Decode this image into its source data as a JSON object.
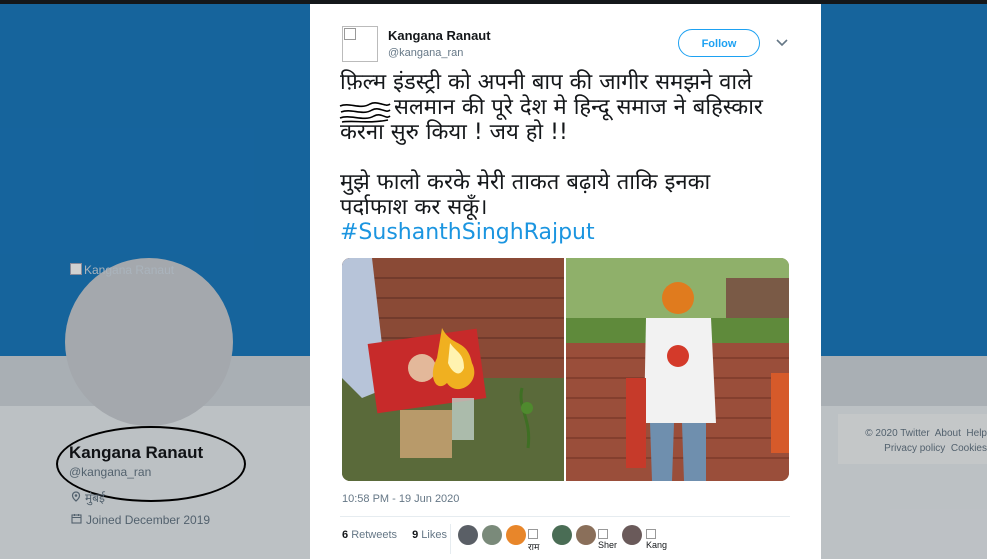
{
  "background_profile": {
    "avatar_alt": "Kangana Ranaut",
    "name": "Kangana Ranaut",
    "handle": "@kangana_ran",
    "location": "मुंबई",
    "joined": "Joined December 2019",
    "location_icon": "location-pin-icon",
    "calendar_icon": "calendar-icon"
  },
  "footer": {
    "row1": [
      "© 2020 Twitter",
      "About",
      "Help"
    ],
    "row2": [
      "Privacy policy",
      "Cookies"
    ]
  },
  "tweet": {
    "author_name": "Kangana Ranaut",
    "author_handle": "@kangana_ran",
    "follow_label": "Follow",
    "text_line1": "फ़िल्म इंडस्ट्री को अपनी बाप की जागीर समझने वाले",
    "text_line2": "सलमान की पूरे देश मे हिन्दू समाज ने बहिस्कार",
    "text_line3": "करना सुरु किया ! जय हो !!",
    "text_line4": "मुझे फालो करके मेरी ताकत बढ़ाये ताकि इनका",
    "text_line5": "पर्दाफाश कर सकूँ।",
    "hashtag": "#SushanthSinghRajput",
    "timestamp": "10:58 PM - 19 Jun 2020",
    "retweets_count": "6",
    "retweets_label": "Retweets",
    "likes_count": "9",
    "likes_label": "Likes",
    "likers_text": [
      "राम",
      "Sher",
      "Kang"
    ]
  },
  "colors": {
    "accent": "#1da1f2",
    "banner": "#1b7abf",
    "link": "#1b95e0"
  }
}
